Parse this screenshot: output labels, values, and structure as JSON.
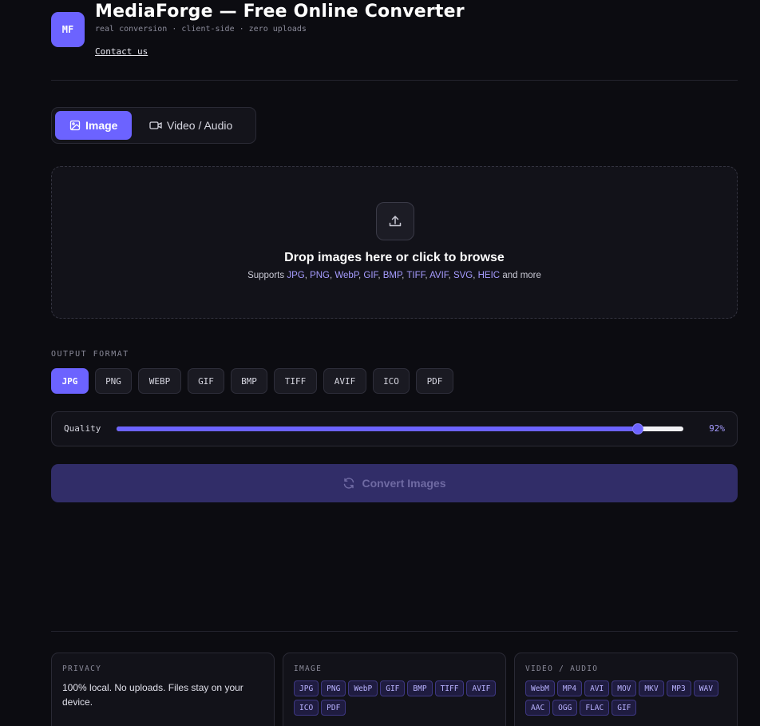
{
  "header": {
    "logo_text": "MF",
    "title": "MediaForge — Free Online Converter",
    "subtitle": "real conversion · client-side · zero uploads",
    "contact_label": "Contact us"
  },
  "tabs": [
    {
      "label": "Image",
      "icon": "image-icon",
      "active": true
    },
    {
      "label": "Video / Audio",
      "icon": "video-camera-icon",
      "active": false
    }
  ],
  "dropzone": {
    "icon": "upload-icon",
    "title": "Drop images here or click to browse",
    "supports_prefix": "Supports",
    "formats": [
      "JPG",
      "PNG",
      "WebP",
      "GIF",
      "BMP",
      "TIFF",
      "AVIF",
      "SVG",
      "HEIC"
    ],
    "supports_suffix": "and more"
  },
  "output_format": {
    "label": "OUTPUT FORMAT",
    "options": [
      "JPG",
      "PNG",
      "WEBP",
      "GIF",
      "BMP",
      "TIFF",
      "AVIF",
      "ICO",
      "PDF"
    ],
    "selected": "JPG"
  },
  "quality": {
    "label": "Quality",
    "value": 92,
    "value_text": "92%"
  },
  "convert": {
    "label": "Convert Images",
    "icon": "refresh-icon"
  },
  "footer": {
    "privacy": {
      "label": "PRIVACY",
      "text": "100% local. No uploads. Files stay on your device."
    },
    "image": {
      "label": "IMAGE",
      "formats": [
        "JPG",
        "PNG",
        "WebP",
        "GIF",
        "BMP",
        "TIFF",
        "AVIF",
        "ICO",
        "PDF"
      ]
    },
    "video_audio": {
      "label": "VIDEO / AUDIO",
      "formats": [
        "WebM",
        "MP4",
        "AVI",
        "MOV",
        "MKV",
        "MP3",
        "WAV",
        "AAC",
        "OGG",
        "FLAC",
        "GIF"
      ]
    }
  },
  "colors": {
    "accent": "#6c63ff",
    "background": "#0c0c11",
    "convert_disabled": "#312d68"
  }
}
